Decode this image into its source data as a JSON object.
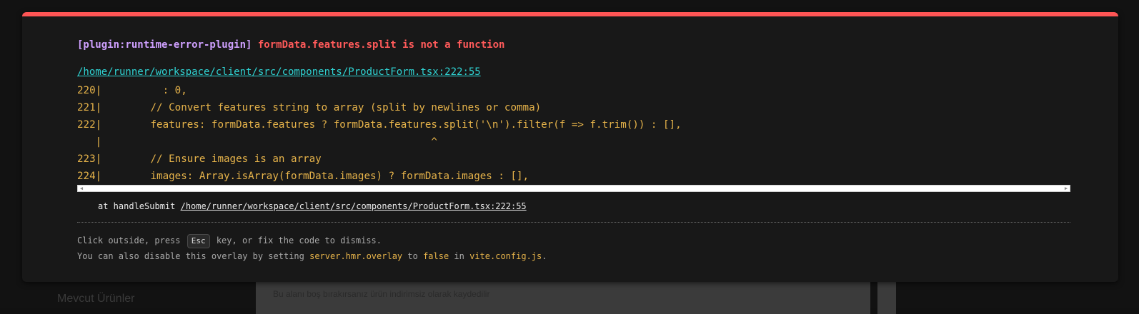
{
  "background": {
    "heading": "Mevcut Ürünler",
    "hint": "Bu alanı boş bırakırsanız ürün indirimsiz olarak kaydedilir"
  },
  "error": {
    "plugin": "[plugin:runtime-error-plugin]",
    "message": "formData.features.split is not a function",
    "file": "/home/runner/workspace/client/src/components/ProductForm.tsx:222:55",
    "frame_lines": [
      "220|          : 0,",
      "221|        // Convert features string to array (split by newlines or comma)",
      "222|        features: formData.features ? formData.features.split('\\n').filter(f => f.trim()) : [],",
      "   |                                                      ^",
      "223|        // Ensure images is an array",
      "224|        images: Array.isArray(formData.images) ? formData.images : [],"
    ],
    "stack_prefix": "at handleSubmit ",
    "stack_link": "/home/runner/workspace/client/src/components/ProductForm.tsx:222:55"
  },
  "tip": {
    "line1_a": "Click outside, press ",
    "esc_key": "Esc",
    "line1_b": " key, or fix the code to dismiss.",
    "line2_a": "You can also disable this overlay by setting ",
    "line2_code1": "server.hmr.overlay",
    "line2_b": " to ",
    "line2_code2": "false",
    "line2_c": " in ",
    "line2_code3": "vite.config.js",
    "line2_d": "."
  },
  "colors": {
    "accent_bar": "#ff5555",
    "plugin": "#cfa0ff",
    "error": "#ff5a5a",
    "link": "#2fd3d3",
    "code": "#e6b34a"
  }
}
